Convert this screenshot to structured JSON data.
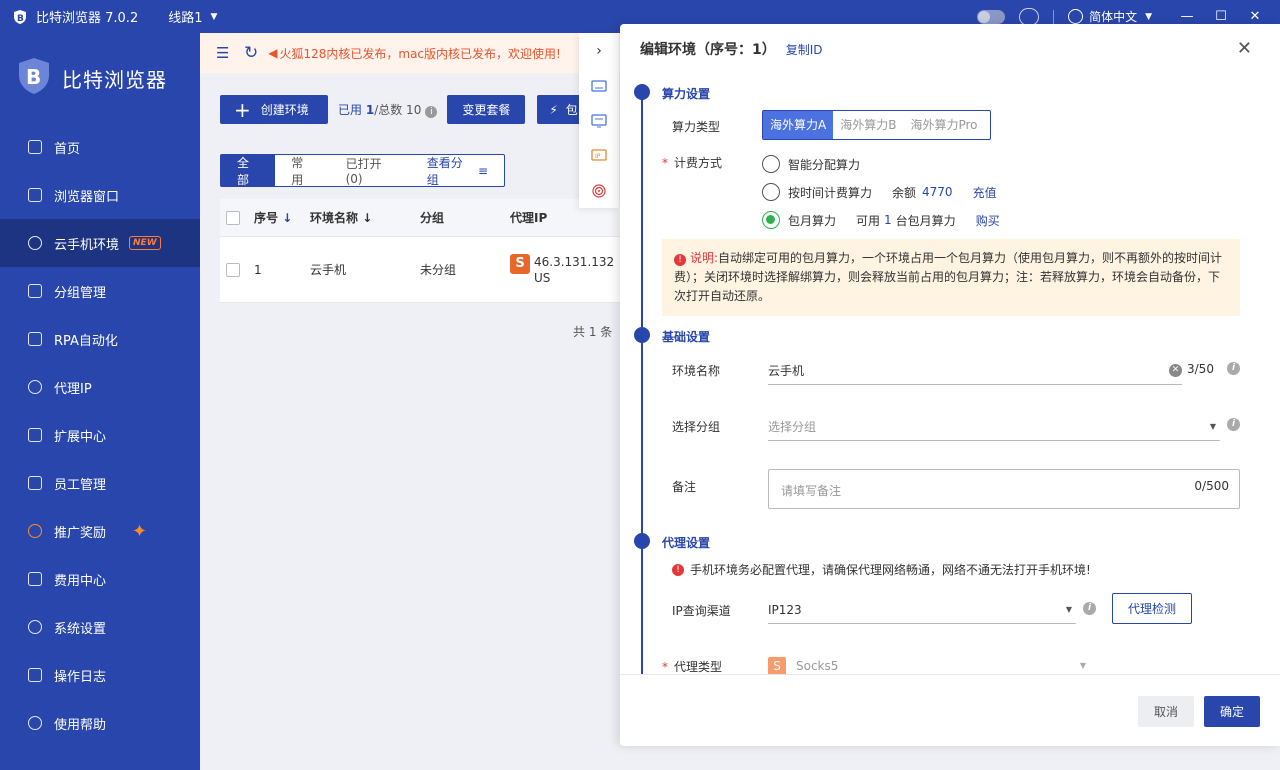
{
  "titlebar": {
    "app_title": "比特浏览器 7.0.2",
    "route": "线路1",
    "language": "简体中文"
  },
  "sidebar": {
    "brand": "比特浏览器",
    "items": [
      {
        "label": "首页",
        "icon": "home-icon"
      },
      {
        "label": "浏览器窗口",
        "icon": "grid-icon"
      },
      {
        "label": "云手机环境",
        "icon": "cloud-icon",
        "badge": "NEW",
        "active": true
      },
      {
        "label": "分组管理",
        "icon": "layers-icon"
      },
      {
        "label": "RPA自动化",
        "icon": "robot-icon"
      },
      {
        "label": "代理IP",
        "icon": "location-icon"
      },
      {
        "label": "扩展中心",
        "icon": "puzzle-icon"
      },
      {
        "label": "员工管理",
        "icon": "users-icon"
      },
      {
        "label": "推广奖励",
        "icon": "gift-icon"
      },
      {
        "label": "费用中心",
        "icon": "wallet-icon"
      },
      {
        "label": "系统设置",
        "icon": "gear-icon"
      },
      {
        "label": "操作日志",
        "icon": "log-icon"
      },
      {
        "label": "使用帮助",
        "icon": "help-icon"
      }
    ]
  },
  "notice": {
    "text": "火狐128内核已发布，mac版内核已发布，欢迎使用!"
  },
  "toolbar": {
    "create_label": "创建环境",
    "used_label": "已用",
    "used_count": "1",
    "total_label": "/总数 10",
    "change_label": "变更套餐",
    "pack_label": "包"
  },
  "filters": {
    "tabs": [
      "全部",
      "常用",
      "已打开(0)"
    ],
    "group_label": "查看分组"
  },
  "table": {
    "headers": [
      "序号",
      "环境名称",
      "分组",
      "代理IP"
    ],
    "rows": [
      {
        "idx": "1",
        "name": "云手机",
        "group": "未分组",
        "ip_line1": "46.3.131.132",
        "ip_line2": "US"
      }
    ],
    "total_text": "共 1 条"
  },
  "drawer": {
    "title": "编辑环境（序号：1）",
    "copy_id": "复制ID",
    "compute": {
      "section": "算力设置",
      "type_label": "算力类型",
      "types": [
        "海外算力A",
        "海外算力B",
        "海外算力Pro"
      ],
      "billing_label": "计费方式",
      "opt1": "智能分配算力",
      "opt2": "按时间计费算力",
      "balance_label": "余额",
      "balance": "4770",
      "recharge": "充值",
      "opt3": "包月算力",
      "avail_label": "可用",
      "avail_count": "1",
      "avail_suffix": "台包月算力",
      "buy": "购买",
      "alert_title": "说明:",
      "alert_text": "自动绑定可用的包月算力，一个环境占用一个包月算力（使用包月算力，则不再额外的按时间计费）；关闭环境时选择解绑算力，则会释放当前占用的包月算力；注：若释放算力，环境会自动备份，下次打开自动还原。"
    },
    "basic": {
      "section": "基础设置",
      "name_label": "环境名称",
      "name_value": "云手机",
      "name_counter": "3/50",
      "group_label": "选择分组",
      "group_placeholder": "选择分组",
      "remark_label": "备注",
      "remark_placeholder": "请填写备注",
      "remark_counter": "0/500"
    },
    "proxy": {
      "section": "代理设置",
      "warning": "手机环境务必配置代理，请确保代理网络畅通，网络不通无法打开手机环境!",
      "channel_label": "IP查询渠道",
      "channel_value": "IP123",
      "check_button": "代理检测",
      "type_label": "代理类型",
      "type_value": "Socks5"
    },
    "cancel": "取消",
    "confirm": "确定"
  }
}
